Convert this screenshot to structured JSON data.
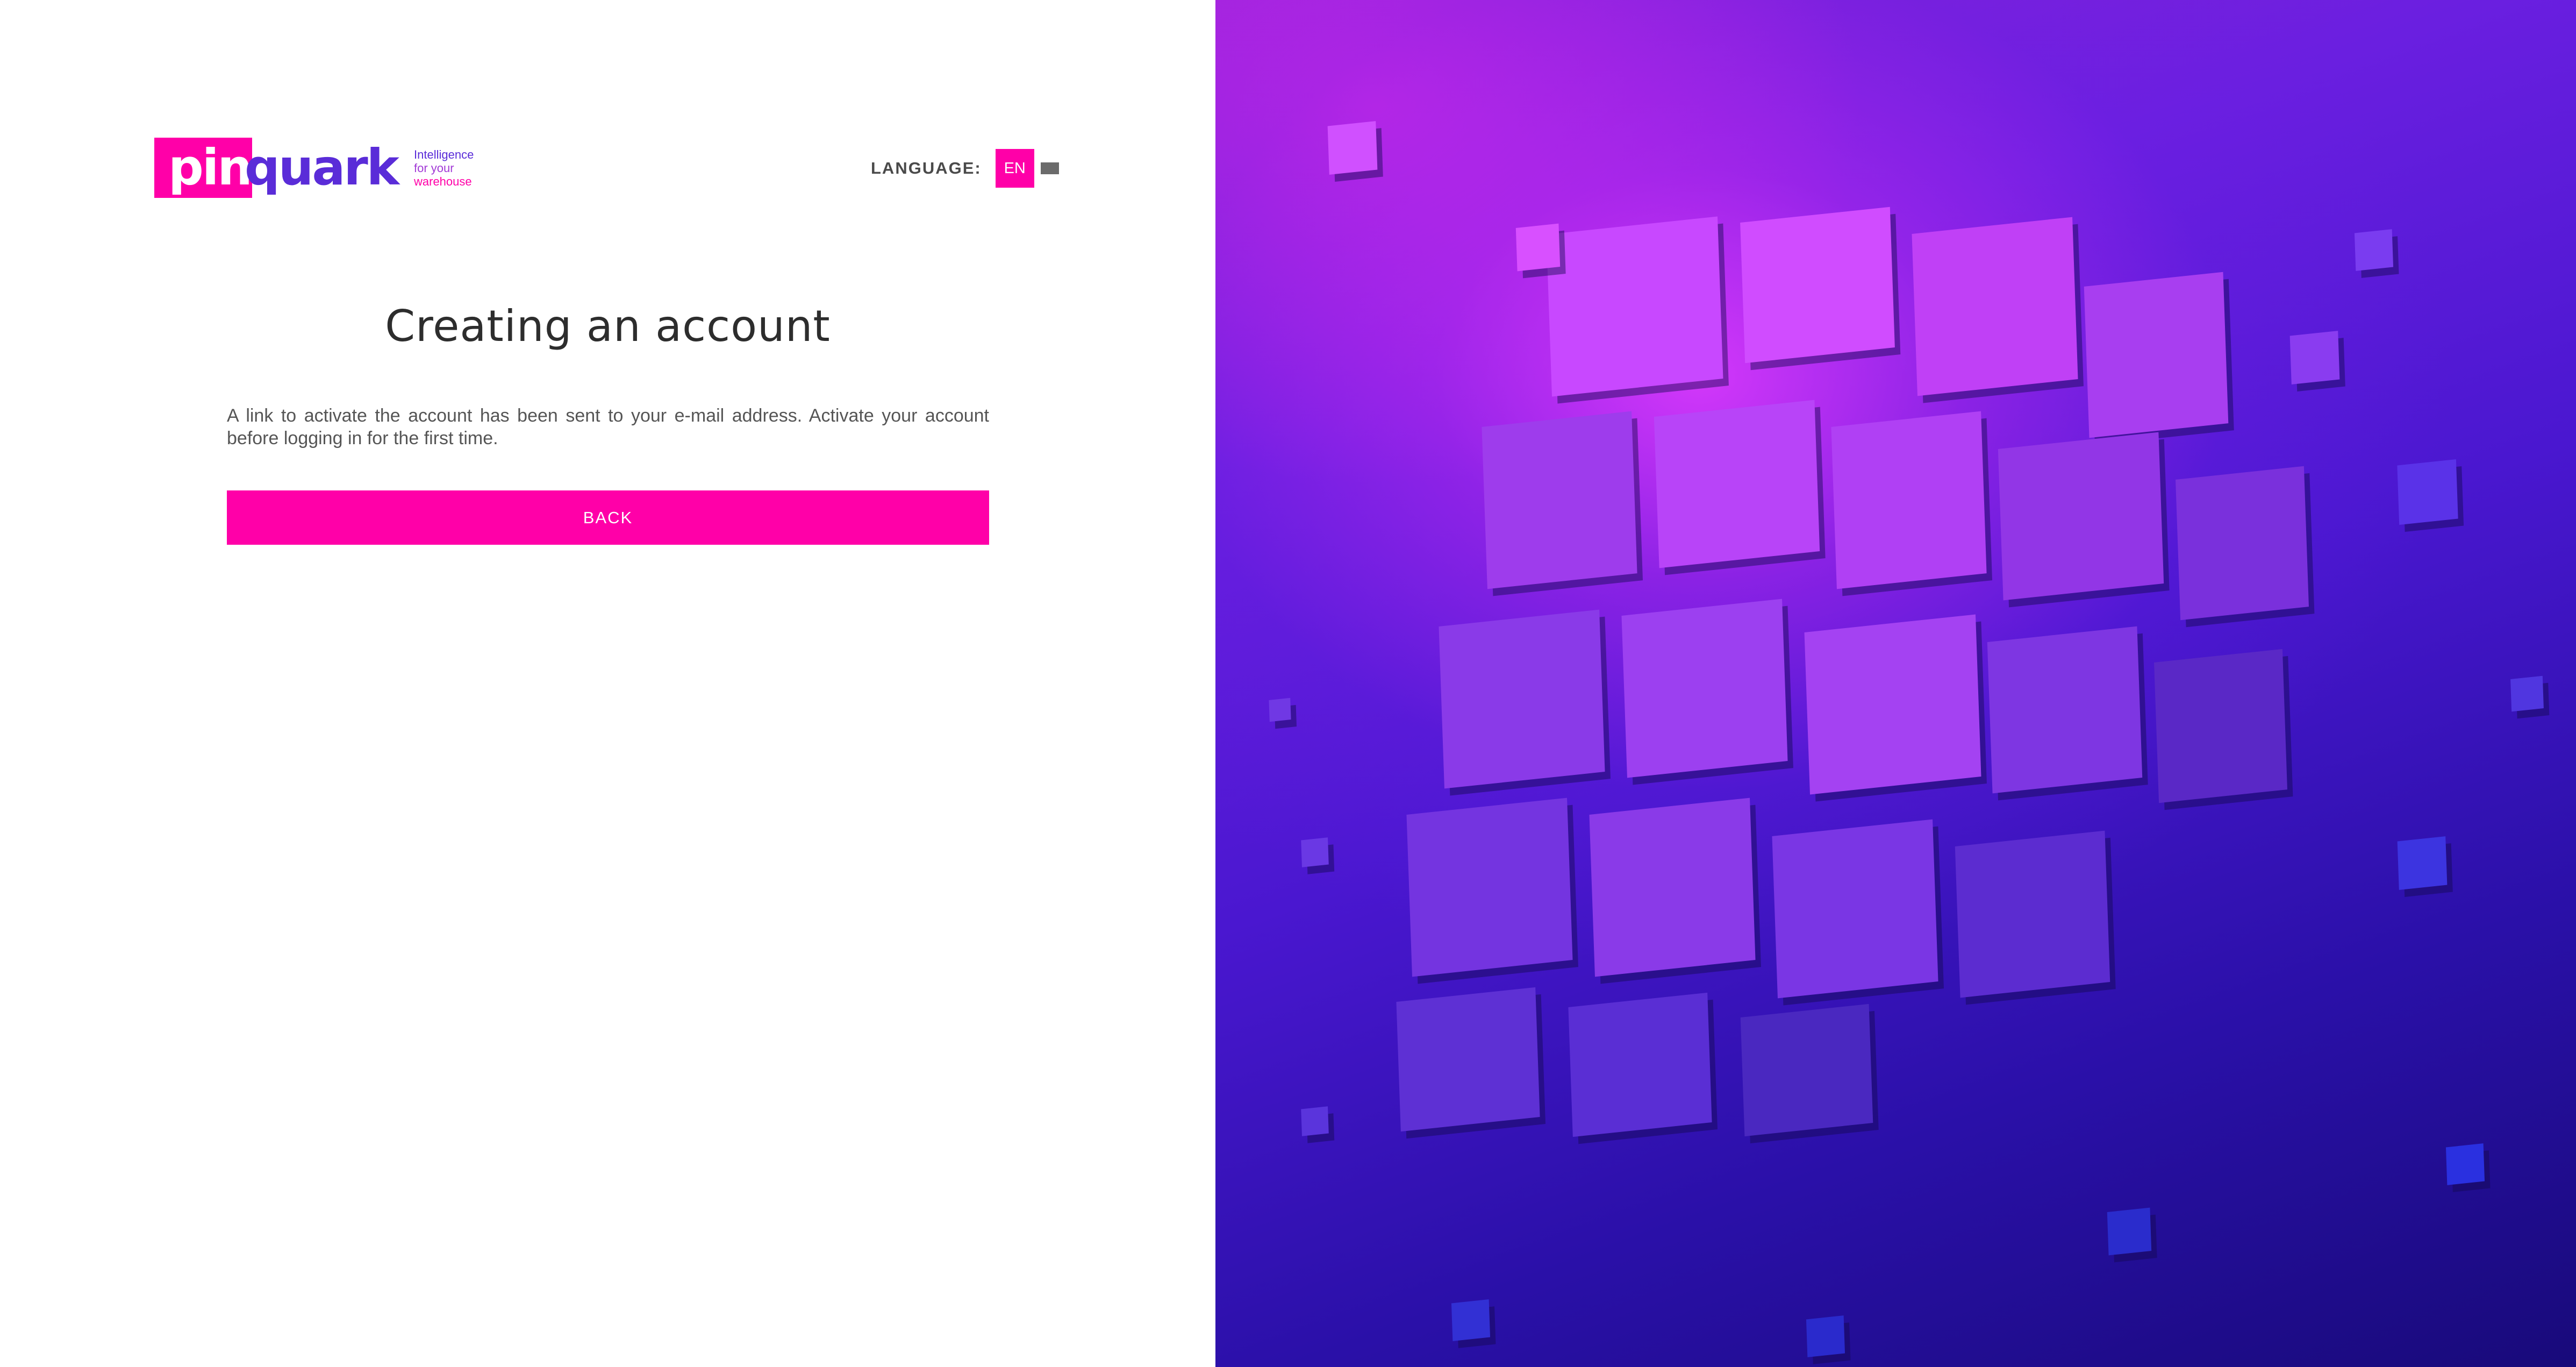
{
  "brand": {
    "logo_pin": "pin",
    "logo_quark": "quark",
    "tagline": [
      "Intelligence",
      "for your",
      "warehouse"
    ],
    "colors": {
      "primary": "#ff00a8",
      "brand_purple": "#5a2cd8"
    }
  },
  "language": {
    "label": "LANGUAGE:",
    "selected": "EN",
    "other_flag_icon": "flag-icon"
  },
  "main": {
    "title": "Creating an account",
    "message": "A link to activate the account has been sent to your e-mail address. Activate your account before logging in for the first time.",
    "back_label": "BACK"
  },
  "illustration": {
    "description_icon": "cubes-illustration"
  }
}
